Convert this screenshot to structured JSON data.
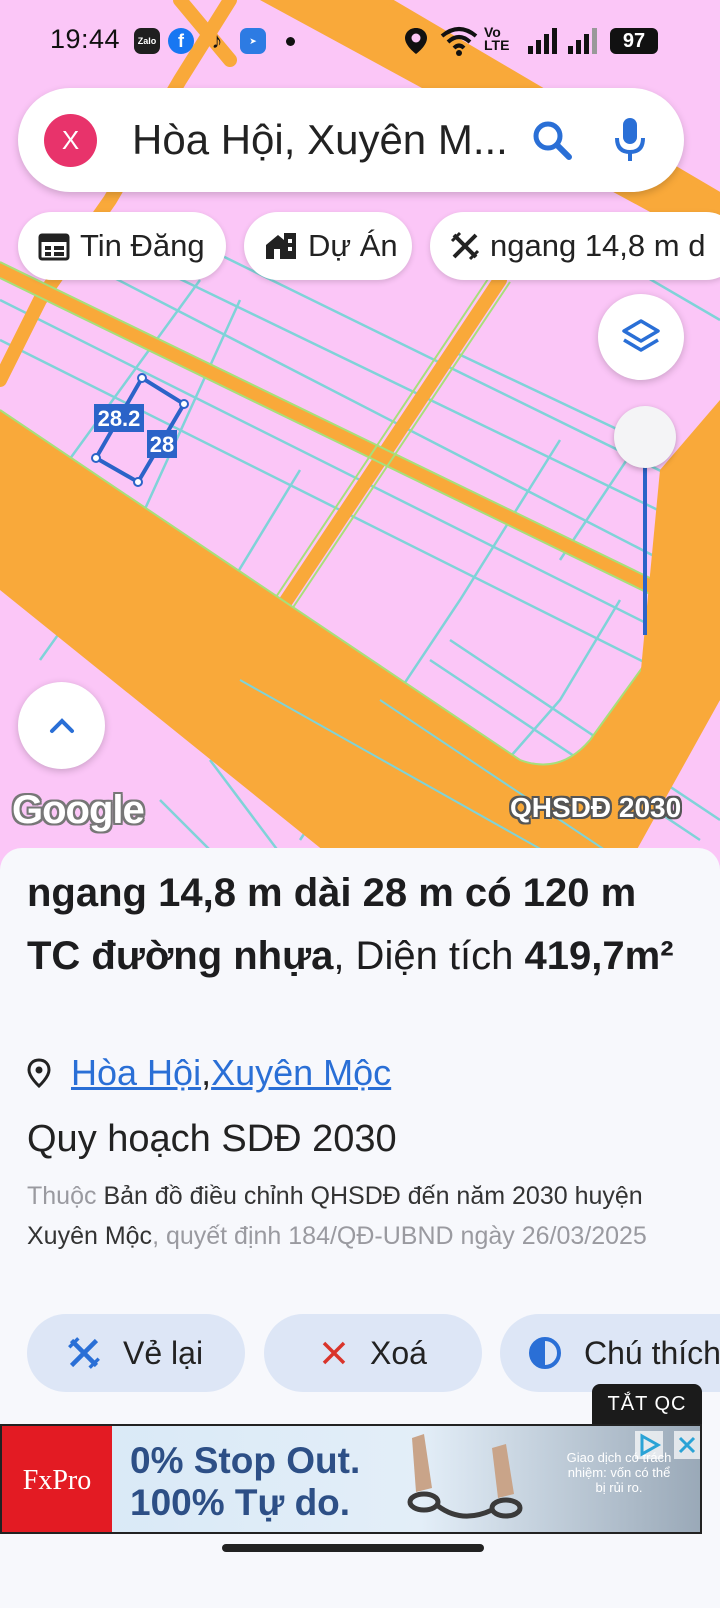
{
  "status_bar": {
    "time": "19:44",
    "apps": [
      "Zalo",
      "Facebook",
      "TikTok",
      "Messenger"
    ],
    "network_label_1": "Vo",
    "network_label_2": "LTE",
    "battery": "97"
  },
  "search": {
    "avatar_letter": "X",
    "query": "Hòa Hội, Xuyên M..."
  },
  "chips": [
    {
      "label": "Tin Đăng",
      "icon": "calendar-icon"
    },
    {
      "label": "Dự Án",
      "icon": "building-icon"
    },
    {
      "label": "ngang 14,8 m d",
      "icon": "ruler-tool-icon"
    }
  ],
  "map": {
    "parcel_label_long": "28.2",
    "parcel_label_short": "28",
    "provider": "Google",
    "layer_name": "QHSDĐ 2030"
  },
  "listing": {
    "title_bold": "ngang 14,8 m dài 28 m có 120 m TC đường nhựa",
    "title_rest": ", Diện tích ",
    "area": "419,7m²",
    "location_1": "Hòa Hội",
    "location_sep": ", ",
    "location_2": "Xuyên Mộc"
  },
  "plan": {
    "heading": "Quy hoạch SDĐ 2030",
    "prefix": "Thuộc ",
    "map_name": "Bản đồ điều chỉnh QHSDĐ đến năm 2030 huyện Xuyên Mộc",
    "decision": ", quyết định 184/QĐ-UBND ngày 26/03/2025"
  },
  "actions": [
    {
      "label": "Vẻ lại",
      "icon": "redraw-icon"
    },
    {
      "label": "Xoá",
      "icon": "close-icon"
    },
    {
      "label": "Chú thích",
      "icon": "contrast-icon"
    }
  ],
  "ad": {
    "close_label": "TẮT QC",
    "brand": "FxPro",
    "line1": "0% Stop Out.",
    "line2": "100% Tự do.",
    "disclaimer": "Giao dịch có trách nhiệm: vốn có thể bị rủi ro."
  },
  "colors": {
    "map_background": "#fbc6f7",
    "road_orange": "#f9a93a",
    "parcel_line": "#7fd3d8",
    "accent_blue": "#2a6fd6",
    "avatar_pink": "#e8336b",
    "button_bg": "#dde6f6",
    "ad_brand_red": "#e31b23"
  }
}
